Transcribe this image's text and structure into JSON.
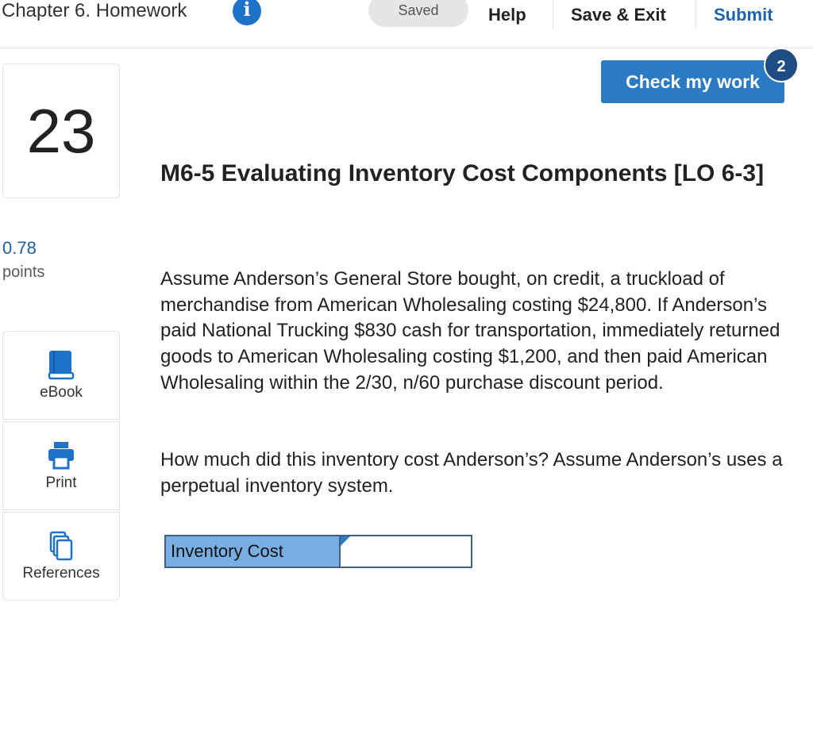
{
  "header": {
    "assignment_title": "Chapter 6. Homework",
    "info_icon_glyph": "i",
    "saved_label": "Saved",
    "help_label": "Help",
    "save_exit_label": "Save & Exit",
    "submit_label": "Submit"
  },
  "sidebar": {
    "question_number": "23",
    "points_value": "0.78",
    "points_label": "points",
    "tools": [
      {
        "label": "eBook",
        "icon": "book-icon"
      },
      {
        "label": "Print",
        "icon": "printer-icon"
      },
      {
        "label": "References",
        "icon": "documents-icon"
      }
    ]
  },
  "main": {
    "check_button_label": "Check my work",
    "check_attempts_badge": "2",
    "question_title": "M6-5 Evaluating Inventory Cost Components [LO 6-3]",
    "paragraph_1": "Assume Anderson’s General Store bought, on credit, a truckload of merchandise from American Wholesaling costing $24,800. If Anderson’s paid National Trucking $830 cash for transportation, immediately returned goods to American Wholesaling costing $1,200, and then paid American Wholesaling within the 2/30, n/60 purchase discount period.",
    "paragraph_2": "How much did this inventory cost Anderson’s? Assume Anderson’s uses a perpetual inventory system.",
    "answer_label": "Inventory Cost",
    "answer_value": ""
  },
  "colors": {
    "accent_blue": "#2a7ac4",
    "submit_blue": "#1d63ad",
    "badge_navy": "#1e4d83",
    "answer_label_bg": "#79aee5"
  }
}
